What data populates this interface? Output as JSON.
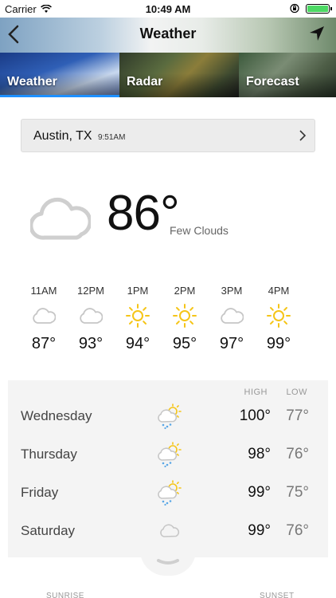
{
  "status_bar": {
    "carrier": "Carrier",
    "time": "10:49 AM"
  },
  "header": {
    "title": "Weather"
  },
  "tabs": [
    {
      "label": "Weather",
      "active": true
    },
    {
      "label": "Radar"
    },
    {
      "label": "Forecast"
    }
  ],
  "location": {
    "city": "Austin, TX",
    "time": "9:51AM"
  },
  "current": {
    "temp": "86°",
    "condition": "Few Clouds",
    "icon": "cloud-icon"
  },
  "hourly": [
    {
      "hour": "11AM",
      "temp": "87°",
      "icon": "cloud-icon"
    },
    {
      "hour": "12PM",
      "temp": "93°",
      "icon": "cloud-icon"
    },
    {
      "hour": "1PM",
      "temp": "94°",
      "icon": "sun-icon"
    },
    {
      "hour": "2PM",
      "temp": "95°",
      "icon": "sun-icon"
    },
    {
      "hour": "3PM",
      "temp": "97°",
      "icon": "cloud-icon"
    },
    {
      "hour": "4PM",
      "temp": "99°",
      "icon": "sun-icon"
    }
  ],
  "daily": {
    "high_label": "HIGH",
    "low_label": "LOW",
    "days": [
      {
        "name": "Wednesday",
        "high": "100°",
        "low": "77°",
        "icon": "sun-cloud-rain-icon"
      },
      {
        "name": "Thursday",
        "high": "98°",
        "low": "76°",
        "icon": "sun-cloud-rain-icon"
      },
      {
        "name": "Friday",
        "high": "99°",
        "low": "75°",
        "icon": "sun-cloud-rain-icon"
      },
      {
        "name": "Saturday",
        "high": "99°",
        "low": "76°",
        "icon": "cloud-icon"
      }
    ]
  },
  "bottom": {
    "sunrise_label": "SUNRISE",
    "sunset_label": "SUNSET"
  },
  "colors": {
    "accent": "#1e90ff",
    "sun": "#f5c518",
    "cloud": "#c9c9c9"
  }
}
